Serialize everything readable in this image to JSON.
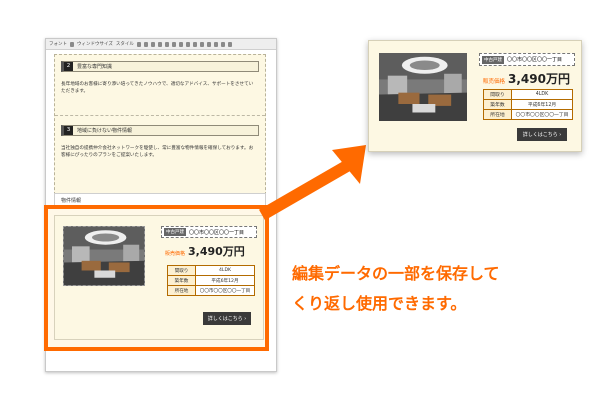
{
  "colors": {
    "accent": "#ff6a00",
    "panel_bg": "#fdf8e3",
    "button_bg": "#3a3a3a"
  },
  "toolbar": {
    "items": [
      "フォント",
      "ウィンドウサイズ",
      "スタイル"
    ]
  },
  "editor": {
    "section2": {
      "number": "2",
      "title": "豊富な専門知識",
      "text": "長年地域のお客様に寄り添い培ってきたノウハウで、適切なアドバイス、サポートをさせていただきます。"
    },
    "section3": {
      "number": "3",
      "title": "地域に負けない物件情報",
      "text": "当社独自の提携仲介会社ネットワークを駆使し、常に豊富な物件情報を確保しております。お客様にぴったりのプランをご提案いたします。"
    },
    "info_label": "物件情報"
  },
  "card": {
    "tag": "中古戸建",
    "address": "〇〇市〇〇区〇〇一丁目",
    "price_label": "販売価格",
    "price": "3,490万円",
    "specs": [
      {
        "key": "間取り",
        "value": "4LDK"
      },
      {
        "key": "築年数",
        "value": "平成6年12月"
      },
      {
        "key": "所在地",
        "value": "〇〇市〇〇区〇〇一丁目"
      }
    ],
    "button_label": "詳しくはこちら ›"
  },
  "caption": {
    "line1": "編集データの一部を保存して",
    "line2": "くり返し使用できます。"
  }
}
